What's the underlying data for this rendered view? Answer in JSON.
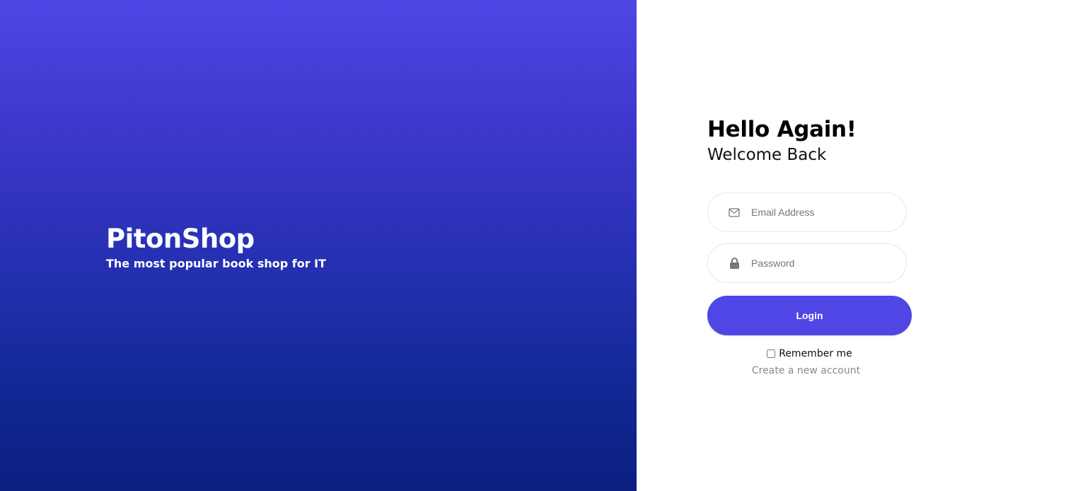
{
  "hero": {
    "brand_title": "PitonShop",
    "tagline": "The most popular book shop for IT"
  },
  "login_form": {
    "title": "Hello Again!",
    "subtitle": "Welcome Back",
    "email_placeholder": "Email Address",
    "email_value": "",
    "email_icon": "envelope-icon",
    "password_placeholder": "Password",
    "password_value": "",
    "password_icon": "lock-icon",
    "login_label": "Login",
    "remember_label": "Remember me",
    "remember_checked": false,
    "create_account_label": "Create a new account"
  },
  "colors": {
    "accent": "#4f46e5",
    "hero_gradient_top": "#4f46e5",
    "hero_gradient_bottom": "#0a1f80"
  }
}
